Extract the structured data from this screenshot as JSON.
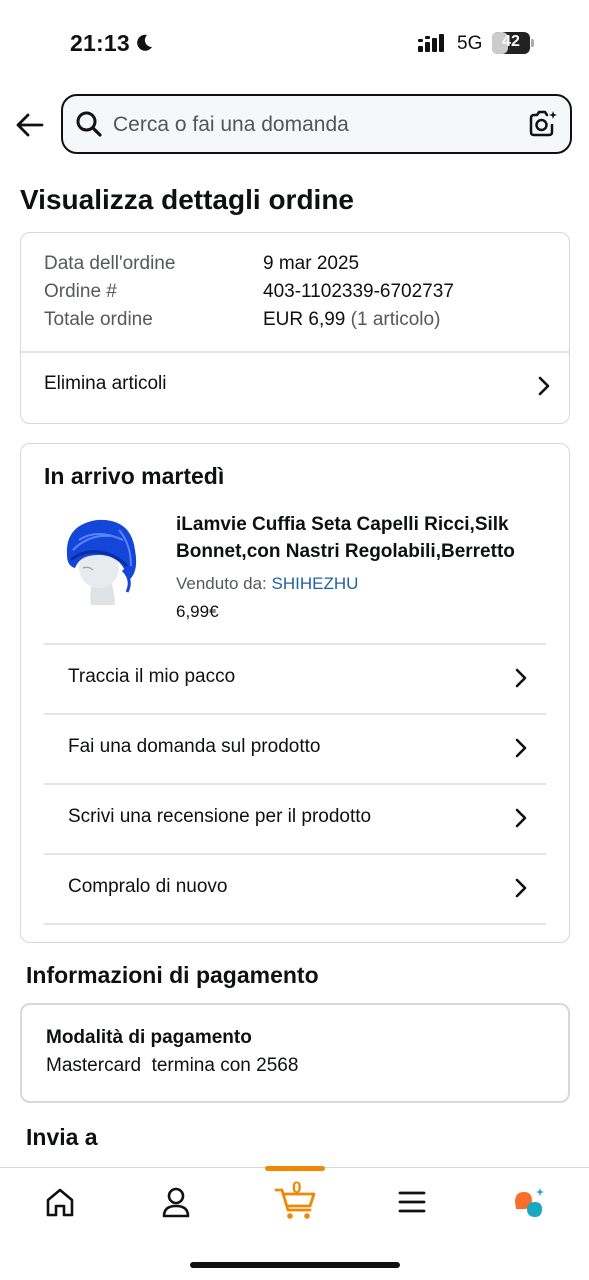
{
  "status_bar": {
    "time": "21:13",
    "network": "5G",
    "battery_level": "42",
    "battery_fraction": 0.42
  },
  "search": {
    "placeholder": "Cerca o fai una domanda"
  },
  "page_title": "Visualizza dettagli ordine",
  "order": {
    "date_label": "Data dell'ordine",
    "date_value": "9 mar 2025",
    "number_label": "Ordine #",
    "number_value": "403-1102339-6702737",
    "total_label": "Totale ordine",
    "total_value": "EUR 6,99",
    "total_items": "(1 articolo)",
    "delete_items_label": "Elimina articoli"
  },
  "arrival": {
    "title": "In arrivo martedì",
    "product": {
      "name": "iLamvie Cuffia Seta Capelli Ricci,Silk Bonnet,con Nastri Regolabili,Berretto",
      "seller_prefix": "Venduto da: ",
      "seller_name": "SHIHEZHU",
      "price": "6,99€"
    },
    "actions": [
      {
        "label": "Traccia il mio pacco"
      },
      {
        "label": "Fai una domanda sul prodotto"
      },
      {
        "label": "Scrivi una recensione per il prodotto"
      },
      {
        "label": "Compralo di nuovo"
      }
    ]
  },
  "payment": {
    "section_title": "Informazioni di pagamento",
    "method_label": "Modalità di pagamento",
    "method_value": "Mastercard  termina con 2568"
  },
  "ship_to": {
    "section_title": "Invia a"
  },
  "bottom_nav": {
    "cart_count": "0",
    "accent_color": "#f08804",
    "items": [
      {
        "icon": "home-icon"
      },
      {
        "icon": "account-icon"
      },
      {
        "icon": "cart-icon"
      },
      {
        "icon": "menu-icon"
      },
      {
        "icon": "rufus-ai-icon"
      }
    ]
  }
}
